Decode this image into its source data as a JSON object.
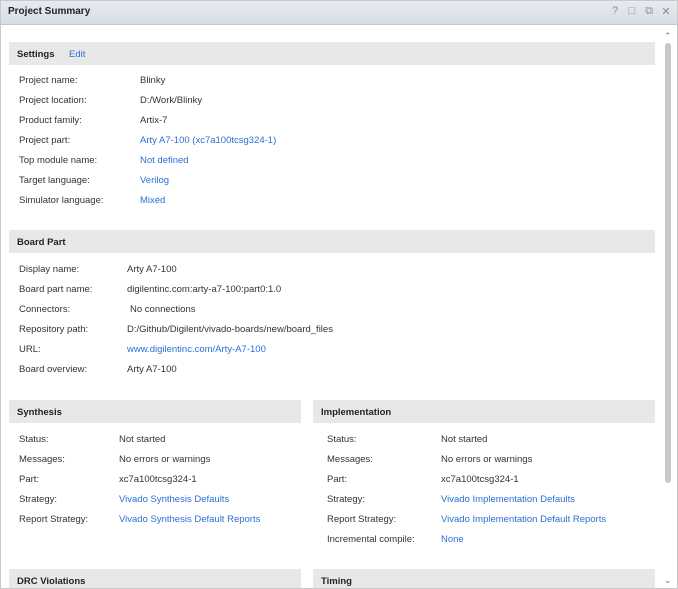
{
  "window": {
    "title": "Project Summary",
    "icons": [
      "help-icon",
      "restore-icon",
      "maximize-icon",
      "close-icon"
    ]
  },
  "settings": {
    "header": "Settings",
    "edit_label": "Edit",
    "rows": [
      {
        "label": "Project name:",
        "value": "Blinky",
        "link": false
      },
      {
        "label": "Project location:",
        "value": "D:/Work/Blinky",
        "link": false
      },
      {
        "label": "Product family:",
        "value": "Artix-7",
        "link": false
      },
      {
        "label": "Project part:",
        "value": "Arty A7-100 (xc7a100tcsg324-1)",
        "link": true
      },
      {
        "label": "Top module name:",
        "value": "Not defined",
        "link": true
      },
      {
        "label": "Target language:",
        "value": "Verilog",
        "link": true
      },
      {
        "label": "Simulator language:",
        "value": "Mixed",
        "link": true
      }
    ]
  },
  "board_part": {
    "header": "Board Part",
    "rows": [
      {
        "label": "Display name:",
        "value": "Arty A7-100",
        "link": false
      },
      {
        "label": "Board part name:",
        "value": "digilentinc.com:arty-a7-100:part0:1.0",
        "link": false
      },
      {
        "label": "Connectors:",
        "value": "No connections",
        "link": false
      },
      {
        "label": "Repository path:",
        "value": "D:/Github/Digilent/vivado-boards/new/board_files",
        "link": false
      },
      {
        "label": "URL:",
        "value": "www.digilentinc.com/Arty-A7-100",
        "link": true
      },
      {
        "label": "Board overview:",
        "value": "Arty A7-100",
        "link": false
      }
    ]
  },
  "synthesis": {
    "header": "Synthesis",
    "rows": [
      {
        "label": "Status:",
        "value": "Not started",
        "link": false
      },
      {
        "label": "Messages:",
        "value": "No errors or warnings",
        "link": false
      },
      {
        "label": "Part:",
        "value": "xc7a100tcsg324-1",
        "link": false
      },
      {
        "label": "Strategy:",
        "value": "Vivado Synthesis Defaults",
        "link": true
      },
      {
        "label": "Report Strategy:",
        "value": "Vivado Synthesis Default Reports",
        "link": true
      }
    ]
  },
  "implementation": {
    "header": "Implementation",
    "rows": [
      {
        "label": "Status:",
        "value": "Not started",
        "link": false
      },
      {
        "label": "Messages:",
        "value": "No errors or warnings",
        "link": false
      },
      {
        "label": "Part:",
        "value": "xc7a100tcsg324-1",
        "link": false
      },
      {
        "label": "Strategy:",
        "value": "Vivado Implementation Defaults",
        "link": true
      },
      {
        "label": "Report Strategy:",
        "value": "Vivado Implementation Default Reports",
        "link": true
      },
      {
        "label": "Incremental compile:",
        "value": "None",
        "link": true
      }
    ]
  },
  "drc": {
    "header": "DRC Violations"
  },
  "timing": {
    "header": "Timing"
  }
}
